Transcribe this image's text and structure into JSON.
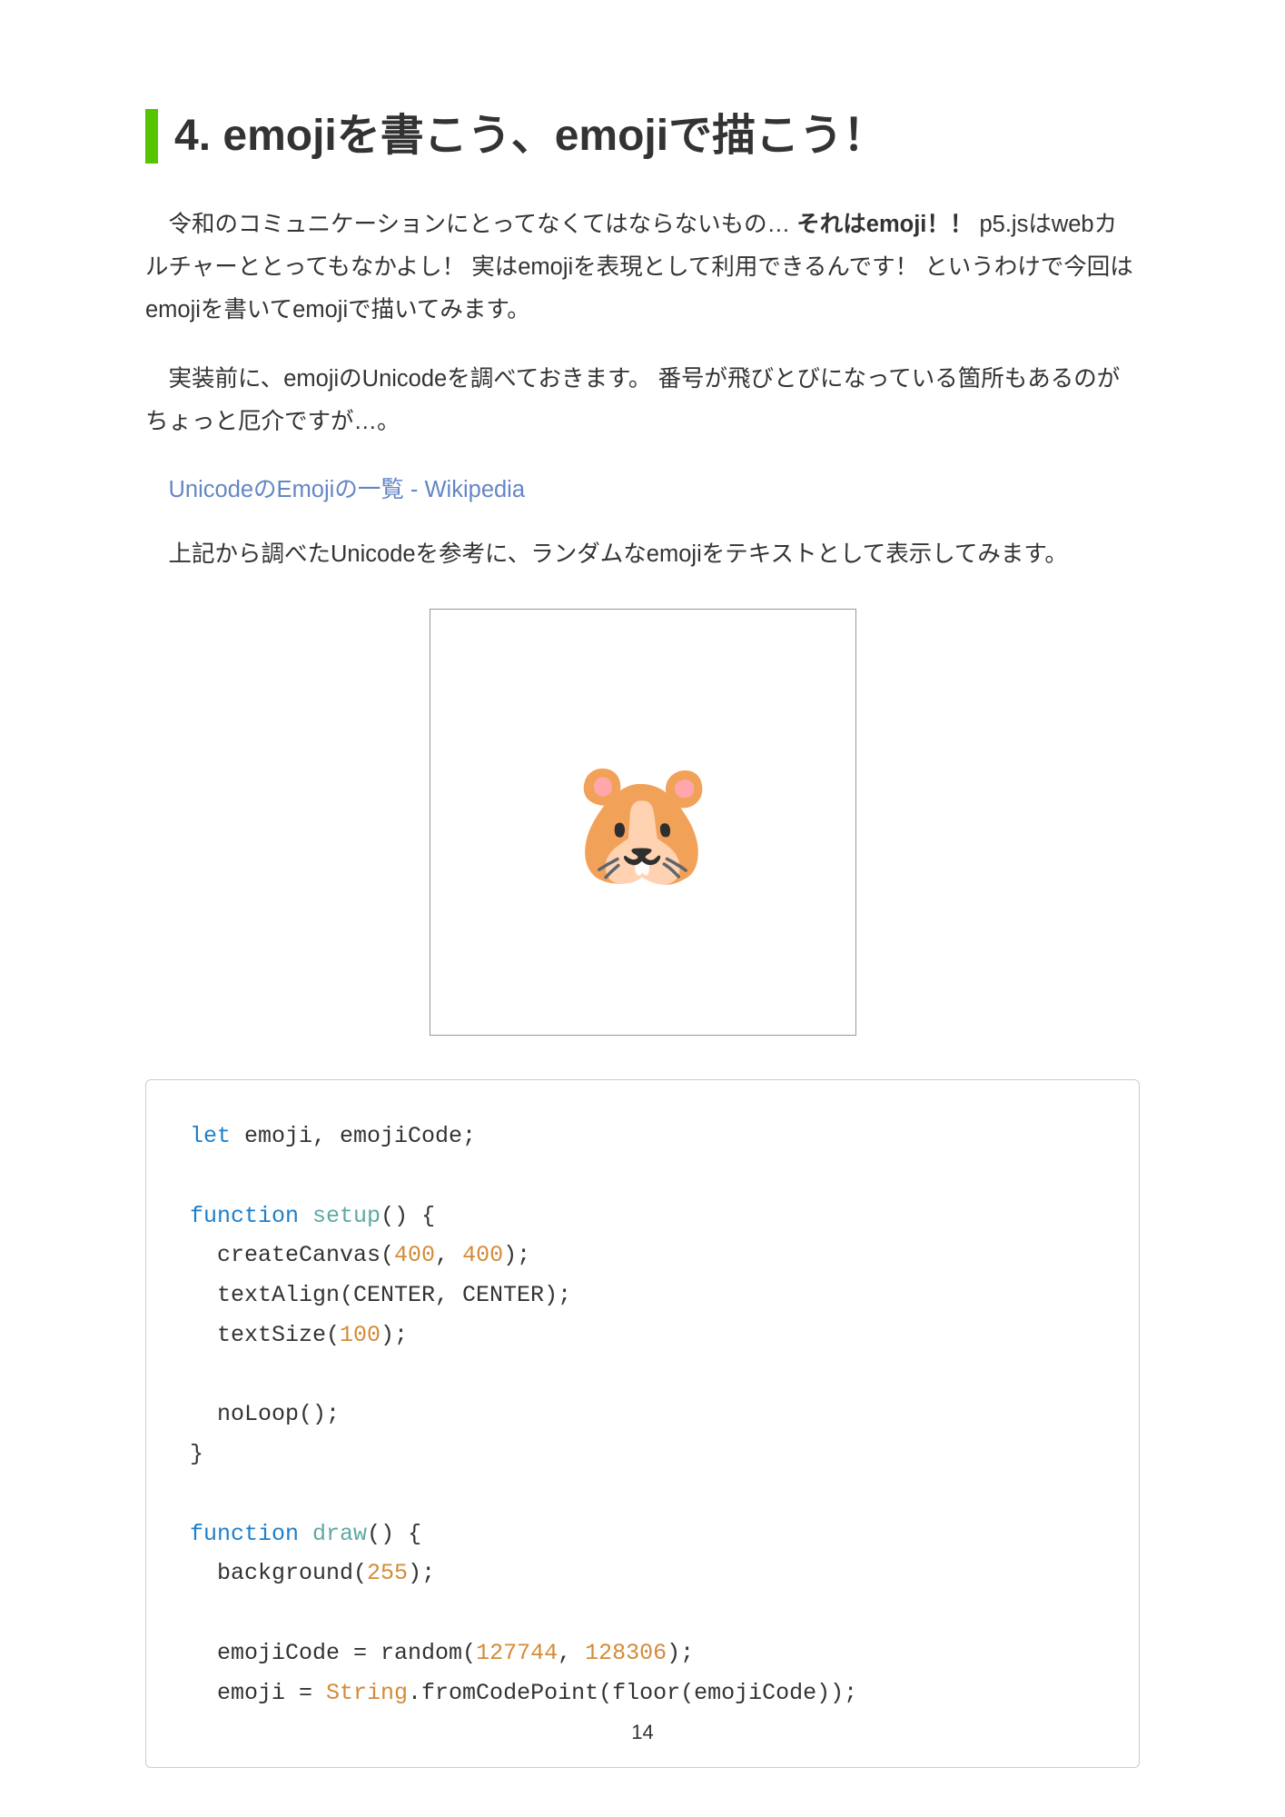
{
  "heading": "4. emojiを書こう、emojiで描こう！",
  "para1_a": "令和のコミュニケーションにとってなくてはならないもの… ",
  "para1_b": "それはemoji！！",
  "para1_c": " p5.jsはwebカルチャーととってもなかよし！ 実はemojiを表現として利用できるんです！ というわけで今回はemojiを書いてemojiで描いてみます。",
  "para2": "実装前に、emojiのUnicodeを調べておきます。 番号が飛びとびになっている箇所もあるのがちょっと厄介ですが…。",
  "link": "UnicodeのEmojiの一覧 - Wikipedia",
  "para3": "上記から調べたUnicodeを参考に、ランダムなemojiをテキストとして表示してみます。",
  "emoji": "🐹",
  "code": {
    "l1_a": "let",
    "l1_b": " emoji, emojiCode;",
    "l3_a": "function",
    "l3_b": " ",
    "l3_c": "setup",
    "l3_d": "() {",
    "l4_a": "  createCanvas(",
    "l4_b": "400",
    "l4_c": ", ",
    "l4_d": "400",
    "l4_e": ");",
    "l5": "  textAlign(CENTER, CENTER);",
    "l6_a": "  textSize(",
    "l6_b": "100",
    "l6_c": ");",
    "l8": "  noLoop();",
    "l9": "}",
    "l11_a": "function",
    "l11_b": " ",
    "l11_c": "draw",
    "l11_d": "() {",
    "l12_a": "  background(",
    "l12_b": "255",
    "l12_c": ");",
    "l14_a": "  emojiCode = random(",
    "l14_b": "127744",
    "l14_c": ", ",
    "l14_d": "128306",
    "l14_e": ");",
    "l15_a": "  emoji = ",
    "l15_b": "String",
    "l15_c": ".fromCodePoint(floor(emojiCode));"
  },
  "page_number": "14"
}
